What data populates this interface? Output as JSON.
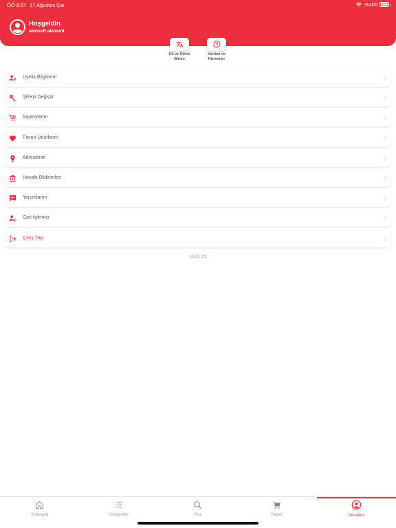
{
  "status_bar": {
    "time": "ÖÖ 8:57",
    "date": "17 Ağustos Çar",
    "battery": "%100"
  },
  "colors": {
    "accent": "#ec2f3c",
    "text": "#555555",
    "muted": "#999999"
  },
  "header": {
    "greeting": "Hoşgeldin",
    "username": "akınsoft akınsoft",
    "avatar_icon": "user-circle-icon"
  },
  "quick_actions": [
    {
      "label_line1": "Dil ve Döviz",
      "label_line2": "Birimi",
      "icon": "translate-icon"
    },
    {
      "label_line1": "Yardım ve",
      "label_line2": "Hizmetler",
      "icon": "help-circle-icon"
    }
  ],
  "menu": [
    {
      "label": "Üyelik Bilgilerim",
      "icon": "user-edit-icon"
    },
    {
      "label": "Şifreyi Değiştir",
      "icon": "key-icon"
    },
    {
      "label": "Siparişlerim",
      "icon": "cart-icon"
    },
    {
      "label": "Favori Ürünlerim",
      "icon": "heart-icon"
    },
    {
      "label": "Adreslerim",
      "icon": "location-pin-icon"
    },
    {
      "label": "Havale Bildirimleri",
      "icon": "bank-icon"
    },
    {
      "label": "Yorumlarım",
      "icon": "comment-icon"
    },
    {
      "label": "Cari İşlemler",
      "icon": "user-settings-icon"
    },
    {
      "label": "Çıkış Yap",
      "icon": "logout-icon"
    }
  ],
  "version": "v3.01.01",
  "tabs": [
    {
      "label": "Anasayfa",
      "icon": "home-icon"
    },
    {
      "label": "Kategoriler",
      "icon": "list-icon"
    },
    {
      "label": "Ara",
      "icon": "search-icon"
    },
    {
      "label": "Sepet",
      "icon": "cart-icon"
    },
    {
      "label": "Hesabım",
      "icon": "account-icon",
      "active": true
    }
  ]
}
